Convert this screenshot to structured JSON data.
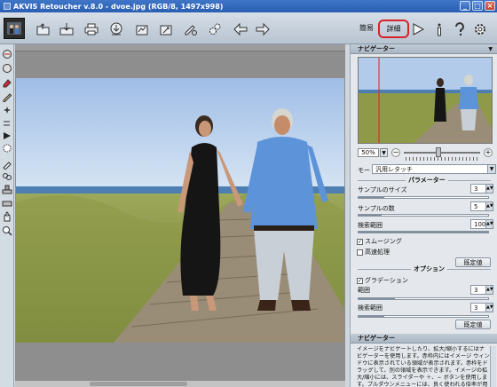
{
  "window": {
    "title": "AKVIS Retoucher v.8.0 - dvoe.jpg (RGB/8, 1497x998)",
    "controls": [
      "_",
      "□",
      "×"
    ]
  },
  "toolbar": {
    "mode_simple": "簡易",
    "mode_detail": "詳細"
  },
  "navigator": {
    "title": "ナビゲーター",
    "zoom": "50%",
    "zoom_minus": "−",
    "zoom_plus": "+"
  },
  "settings": {
    "mode_label": "モード",
    "mode_value": "汎用レタッチ",
    "params_title": "パラメーター",
    "sample_size_label": "サンプルのサイズ",
    "sample_size_value": "3",
    "sample_size_fill": 0.2,
    "sample_count_label": "サンプルの数",
    "sample_count_value": "5",
    "sample_count_fill": 0.18,
    "search_range_label": "検索範囲",
    "search_range_value": "100",
    "search_range_fill": 1.0,
    "smoothing_label": "スムージング",
    "smoothing_checked": "✓",
    "fast_label": "高速処理",
    "default_btn": "既定値",
    "options_title": "オプション",
    "gradation_label": "グラデーション",
    "gradation_checked": "✓",
    "range_label": "範囲",
    "range_value": "3",
    "range_fill": 0.28,
    "opt_search_label": "検索範囲",
    "opt_search_value": "3",
    "opt_search_fill": 0.2,
    "default_btn2": "既定値"
  },
  "help": {
    "title": "ナビゲーター",
    "text": "イメージをナビゲートしたり、拡大/縮小するにはナビゲーターを使用します。赤枠内にはイメージ ウィンドウに表示されている領域が表示されます。赤枠をドラッグして、別の領域を表示できます。イメージの拡大/縮小には、スライダーや ＋、− ボタンを使用します。プルダウンメニューには、良く使われる倍率が用意されています。"
  }
}
